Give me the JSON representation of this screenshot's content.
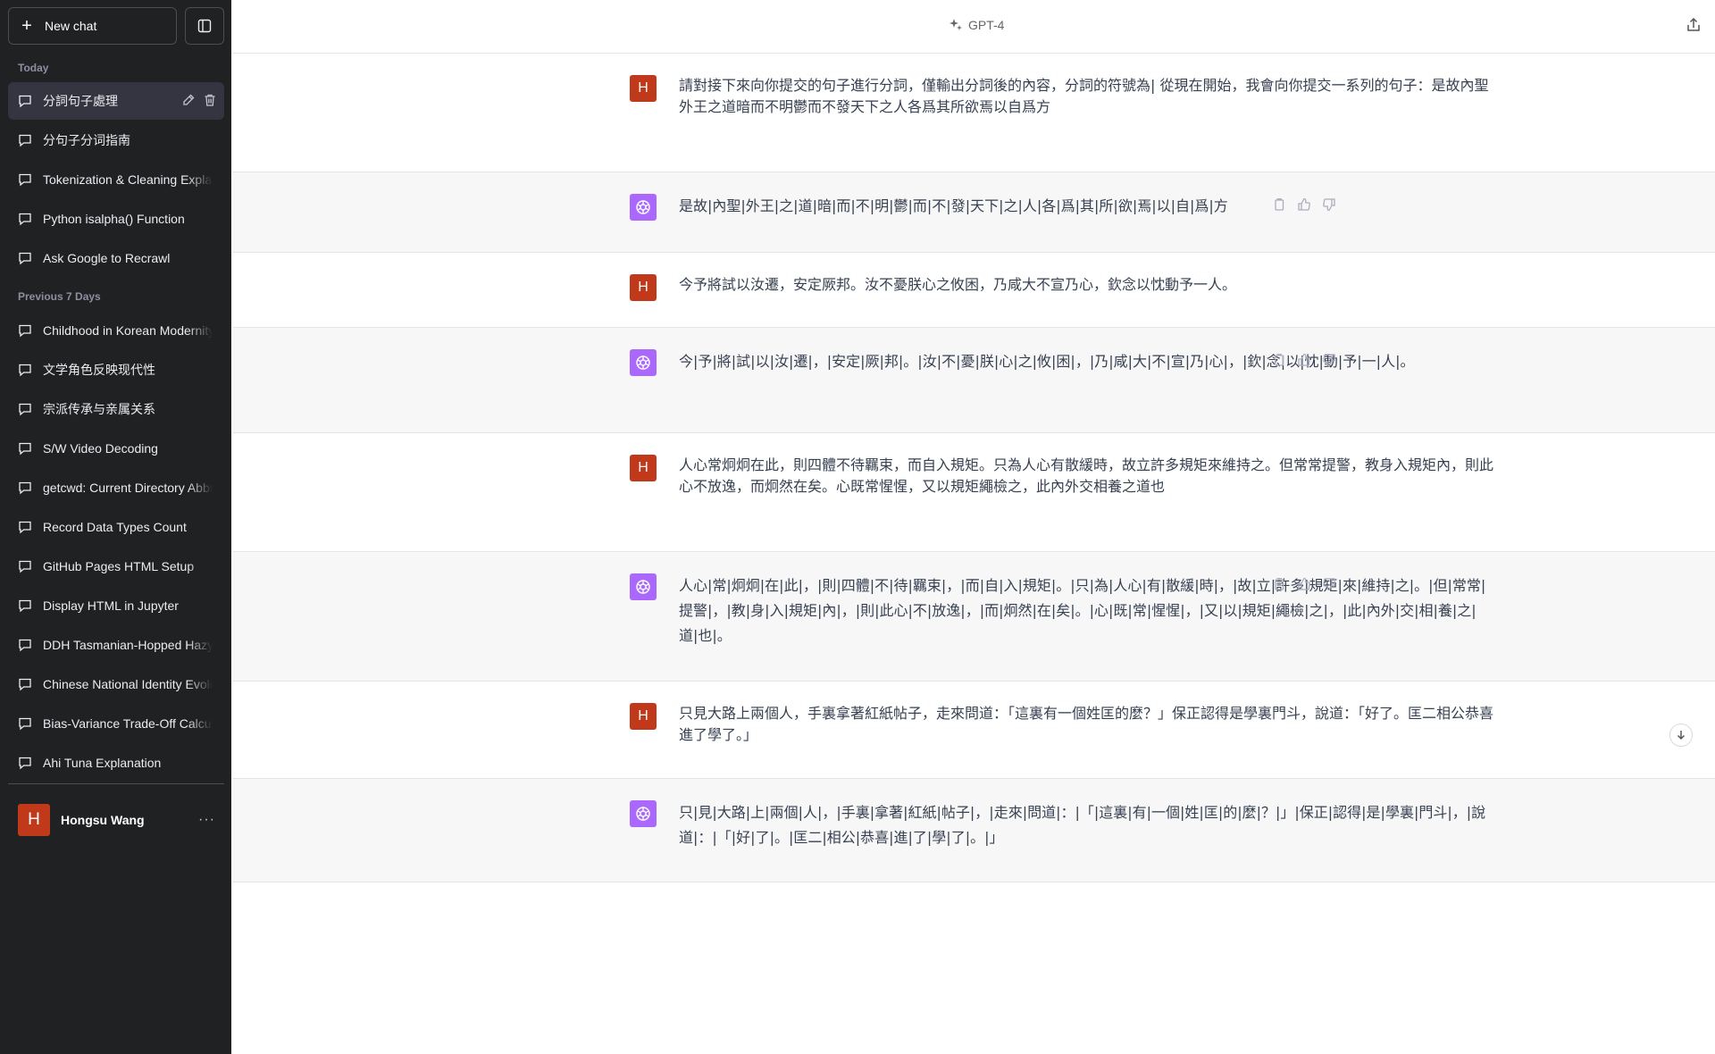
{
  "sidebar": {
    "new_chat_label": "New chat",
    "sections": [
      {
        "label": "Today",
        "items": [
          {
            "label": "分詞句子處理",
            "active": true
          },
          {
            "label": "分句子分词指南"
          },
          {
            "label": "Tokenization & Cleaning Explanation"
          },
          {
            "label": "Python isalpha() Function"
          },
          {
            "label": "Ask Google to Recrawl"
          }
        ]
      },
      {
        "label": "Previous 7 Days",
        "items": [
          {
            "label": "Childhood in Korean Modernity"
          },
          {
            "label": "文学角色反映现代性"
          },
          {
            "label": "宗派传承与亲属关系"
          },
          {
            "label": "S/W Video Decoding"
          },
          {
            "label": "getcwd: Current Directory Abbreviation"
          },
          {
            "label": "Record Data Types Count"
          },
          {
            "label": "GitHub Pages HTML Setup"
          },
          {
            "label": "Display HTML in Jupyter"
          },
          {
            "label": "DDH Tasmanian-Hopped Hazy IPA"
          },
          {
            "label": "Chinese National Identity Evolution"
          },
          {
            "label": "Bias-Variance Trade-Off Calculation"
          },
          {
            "label": "Ahi Tuna Explanation"
          }
        ]
      }
    ],
    "user": {
      "avatar_letter": "H",
      "name": "Hongsu Wang",
      "more": "···"
    }
  },
  "header": {
    "model": "GPT-4"
  },
  "conversation": [
    {
      "role": "user",
      "avatar": "H",
      "text": "請對接下來向你提交的句子進行分詞，僅輸出分詞後的內容，分詞的符號為| 從現在開始，我會向你提交一系列的句子：是故內聖外王之道暗而不明鬱而不發天下之人各爲其所欲焉以自爲方"
    },
    {
      "role": "assistant",
      "text": "是故|內聖|外王|之|道|暗|而|不|明|鬱|而|不|發|天下|之|人|各|爲|其|所|欲|焉|以|自|爲|方"
    },
    {
      "role": "user",
      "avatar": "H",
      "text": "今予將試以汝遷，安定厥邦。汝不憂朕心之攸困，乃咸大不宣乃心，欽念以忱動予一人。"
    },
    {
      "role": "assistant",
      "text": "今|予|將|試|以|汝|遷|，|安定|厥|邦|。|汝|不|憂|朕|心|之|攸|困|，|乃|咸|大|不|宣|乃|心|，|欽|念|以|忱|動|予|一|人|。"
    },
    {
      "role": "user",
      "avatar": "H",
      "text": "人心常炯炯在此，則四體不待羈束，而自入規矩。只為人心有散緩時，故立許多規矩來維持之。但常常提警，教身入規矩內，則此心不放逸，而炯然在矣。心既常惺惺，又以規矩繩檢之，此內外交相養之道也"
    },
    {
      "role": "assistant",
      "text": "人心|常|炯炯|在|此|，|則|四體|不|待|羈束|，|而|自|入|規矩|。|只|為|人心|有|散緩|時|，|故|立|許多|規矩|來|維持|之|。|但|常常|提警|，|教|身|入|規矩|內|，|則|此心|不|放逸|，|而|炯然|在|矣|。|心|既|常|惺惺|，|又|以|規矩|繩檢|之|，|此|內外|交|相|養|之|道|也|。"
    },
    {
      "role": "user",
      "avatar": "H",
      "text": "只見大路上兩個人，手裏拿著紅紙帖子，走來問道：「這裏有一個姓匡的麼？」保正認得是學裏門斗，說道：「好了。匡二相公恭喜進了學了。」"
    },
    {
      "role": "assistant",
      "text": "只|見|大路|上|兩個|人|，|手裏|拿著|紅紙|帖子|，|走來|問道|：|「|這裏|有|一個|姓|匡|的|麼|？|」|保正|認得|是|學裏|門斗|，|說道|：|「|好|了|。|匡二|相公|恭喜|進|了|學|了|。|」"
    }
  ],
  "colors": {
    "sidebar_bg": "#202123",
    "user_avatar": "#c0391b",
    "gpt_avatar": "#ab68ff",
    "assistant_row_bg": "#f7f7f8"
  }
}
